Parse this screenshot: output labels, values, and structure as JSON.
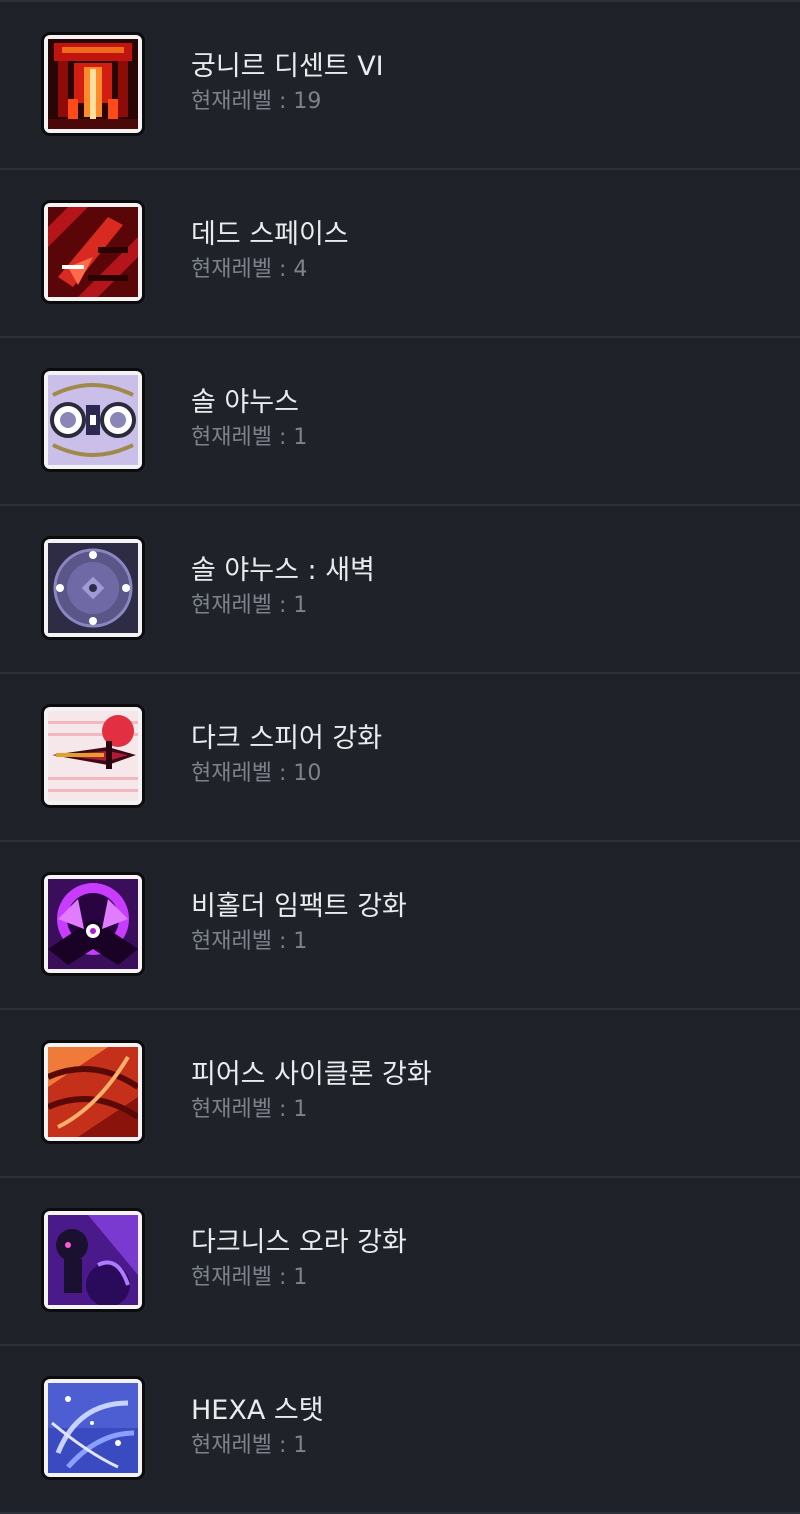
{
  "skills": [
    {
      "name": "궁니르 디센트 VI",
      "level_label": "현재레벨 : 19",
      "icon": "gungnir-descent-icon"
    },
    {
      "name": "데드 스페이스",
      "level_label": "현재레벨 : 4",
      "icon": "dead-space-icon"
    },
    {
      "name": "솔 야누스",
      "level_label": "현재레벨 : 1",
      "icon": "sol-janus-icon"
    },
    {
      "name": "솔 야누스 : 새벽",
      "level_label": "현재레벨 : 1",
      "icon": "sol-janus-dawn-icon"
    },
    {
      "name": "다크 스피어 강화",
      "level_label": "현재레벨 : 10",
      "icon": "dark-spear-icon"
    },
    {
      "name": "비홀더 임팩트 강화",
      "level_label": "현재레벨 : 1",
      "icon": "beholder-impact-icon"
    },
    {
      "name": "피어스 사이클론 강화",
      "level_label": "현재레벨 : 1",
      "icon": "pierce-cyclone-icon"
    },
    {
      "name": "다크니스 오라 강화",
      "level_label": "현재레벨 : 1",
      "icon": "darkness-aura-icon"
    },
    {
      "name": "HEXA 스탯",
      "level_label": "현재레벨 : 1",
      "icon": "hexa-stat-icon"
    }
  ],
  "colors": {
    "background": "#1f2229",
    "divider": "#2c3038",
    "name_text": "#e9ebee",
    "level_text": "#7d828b"
  }
}
